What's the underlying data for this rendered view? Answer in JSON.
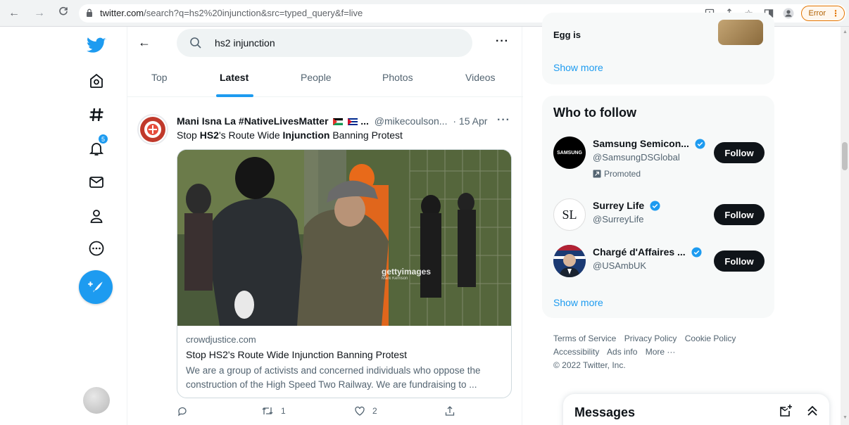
{
  "browser": {
    "url_host": "twitter.com",
    "url_path": "/search?q=hs2%20injunction&src=typed_query&f=live",
    "error_label": "Error"
  },
  "leftnav": {
    "notification_count": "5"
  },
  "search": {
    "query": "hs2 injunction",
    "more": "···"
  },
  "tabs": [
    {
      "label": "Top"
    },
    {
      "label": "Latest"
    },
    {
      "label": "People"
    },
    {
      "label": "Photos"
    },
    {
      "label": "Videos"
    }
  ],
  "tweet": {
    "name": "Mani Isna La #NativeLivesMatter",
    "name_suffix": "...",
    "handle": "@mikecoulson...",
    "time": "· 15 Apr",
    "more": "···",
    "text_prefix": "Stop ",
    "text_bold1": "HS2",
    "text_mid": "'s Route Wide ",
    "text_bold2": "Injunction",
    "text_suffix": " Banning Protest",
    "card": {
      "watermark": "gettyimages",
      "watermark_credit": "Mark Kerrison",
      "domain": "crowdjustice.com",
      "title": "Stop HS2's Route Wide Injunction Banning Protest",
      "description": "We are a group of activists and concerned individuals who oppose the construction of the High Speed Two Railway. We are fundraising to ..."
    },
    "actions": {
      "retweets": "1",
      "likes": "2"
    }
  },
  "trend": {
    "text": "Egg is",
    "show_more": "Show more"
  },
  "who_to_follow": {
    "title": "Who to follow",
    "items": [
      {
        "name": "Samsung Semicon...",
        "handle": "@SamsungDSGlobal",
        "promoted": "Promoted",
        "button": "Follow",
        "avatar_text": "SAMSUNG"
      },
      {
        "name": "Surrey Life",
        "handle": "@SurreyLife",
        "button": "Follow",
        "avatar_text": "SL"
      },
      {
        "name": "Chargé d'Affaires ...",
        "handle": "@USAmbUK",
        "button": "Follow"
      }
    ],
    "show_more": "Show more"
  },
  "footer": {
    "links": [
      "Terms of Service",
      "Privacy Policy",
      "Cookie Policy",
      "Accessibility",
      "Ads info",
      "More ···"
    ],
    "copyright": "© 2022 Twitter, Inc."
  },
  "messages": {
    "title": "Messages"
  },
  "colors": {
    "accent": "#1d9bf0",
    "text": "#0f1419",
    "muted": "#536471",
    "error": "#e37400"
  }
}
